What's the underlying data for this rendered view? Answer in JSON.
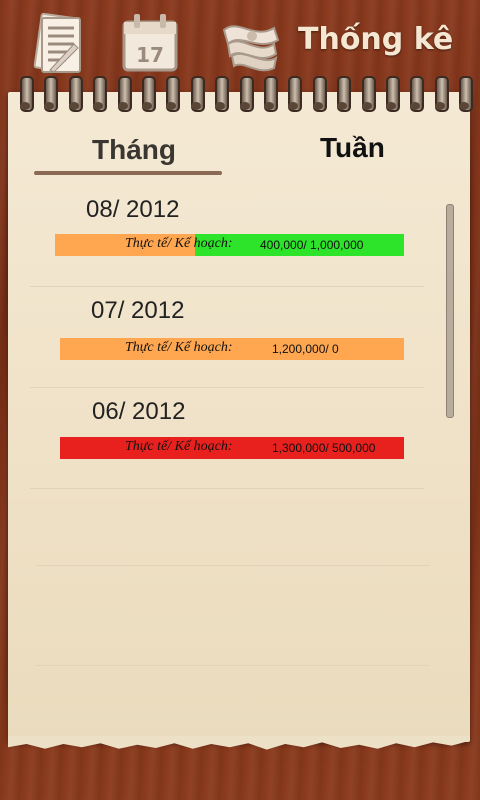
{
  "header": {
    "title": "Thống kê",
    "icons": [
      "notes-icon",
      "calendar-icon",
      "money-icon"
    ],
    "calendar_day": "17"
  },
  "tabs": [
    {
      "label": "Tháng",
      "selected": true
    },
    {
      "label": "Tuần",
      "selected": false
    }
  ],
  "months": [
    {
      "title": "08/ 2012",
      "label": "Thực tế/ Kế hoạch:",
      "value": "400,000/ 1,000,000",
      "progress_fraction": 0.4,
      "color_track": "#2ee42a",
      "color_fill": "#ffa650"
    },
    {
      "title": "07/ 2012",
      "label": "Thực tế/ Kế hoạch:",
      "value": "1,200,000/ 0",
      "progress_fraction": 1.0,
      "color_track": "#ffa650",
      "color_fill": "#ffa650"
    },
    {
      "title": "06/ 2012",
      "label": "Thực tế/ Kế hoạch:",
      "value": "1,300,000/ 500,000",
      "progress_fraction": 1.0,
      "color_track": "#e8201e",
      "color_fill": "#e8201e"
    }
  ]
}
